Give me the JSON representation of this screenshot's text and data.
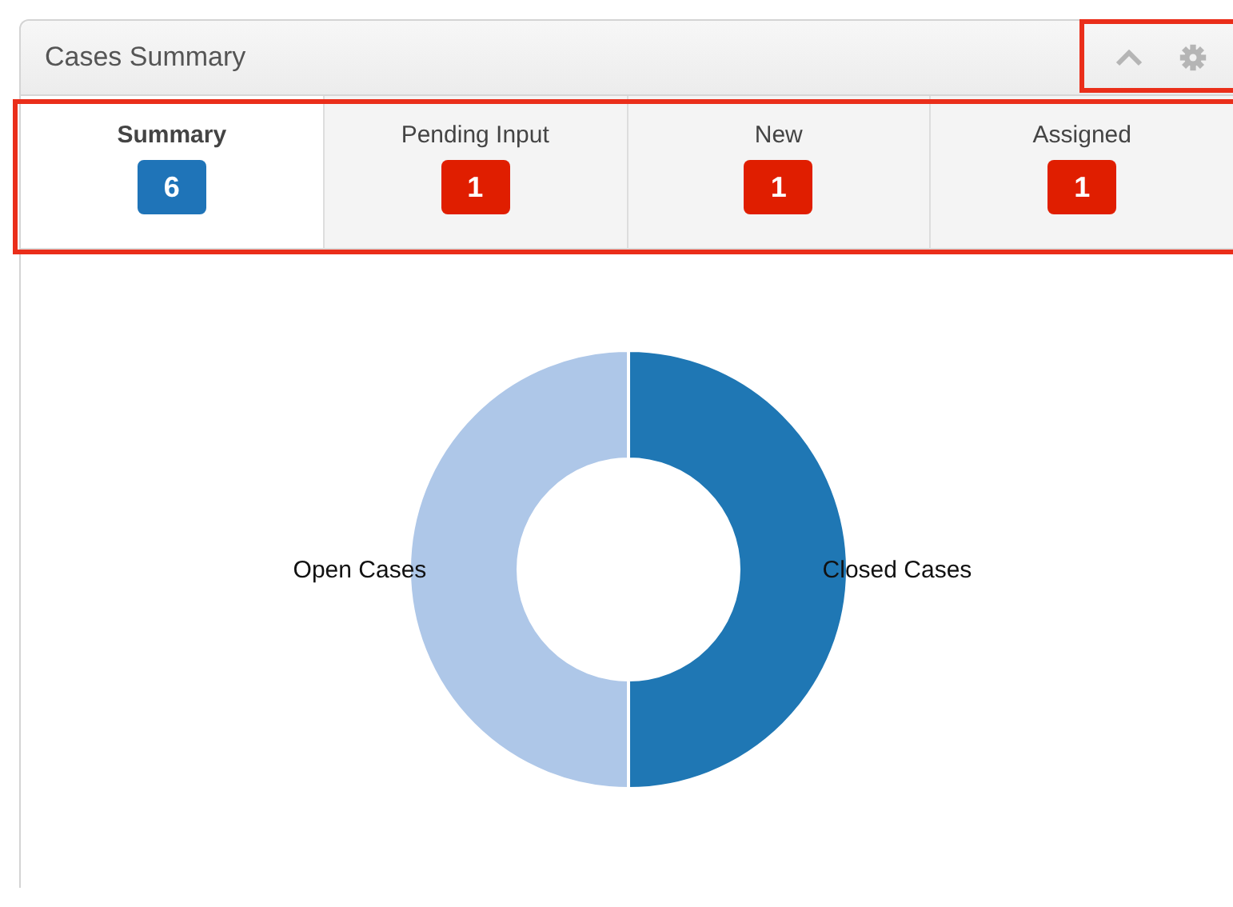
{
  "dashlet": {
    "title": "Cases Summary"
  },
  "tabs": [
    {
      "label": "Summary",
      "count": "6",
      "selected": true,
      "color": "#1f74b8"
    },
    {
      "label": "Pending Input",
      "count": "1",
      "selected": false,
      "color": "#e01e00"
    },
    {
      "label": "New",
      "count": "1",
      "selected": false,
      "color": "#e01e00"
    },
    {
      "label": "Assigned",
      "count": "1",
      "selected": false,
      "color": "#e01e00"
    }
  ],
  "chart_data": {
    "type": "donut",
    "categories": [
      "Open Cases",
      "Closed Cases"
    ],
    "values": [
      50,
      50
    ]
  }
}
